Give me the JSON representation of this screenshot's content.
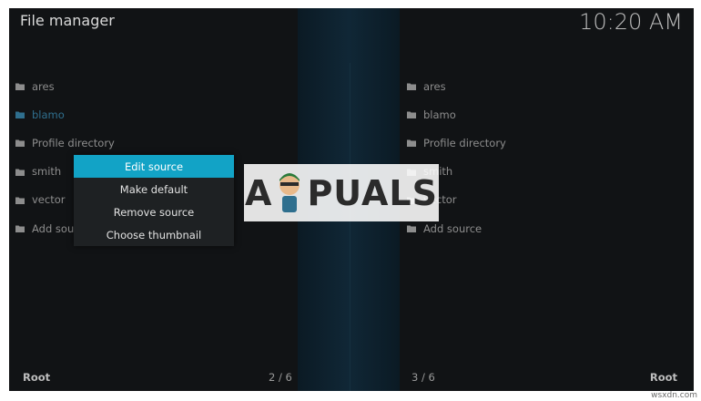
{
  "header": {
    "title": "File manager",
    "clock": "10:20 AM"
  },
  "left_pane": {
    "items": [
      {
        "label": "ares",
        "icon": "folder-icon"
      },
      {
        "label": "blamo",
        "icon": "folder-icon"
      },
      {
        "label": "Profile directory",
        "icon": "folder-icon"
      },
      {
        "label": "smith",
        "icon": "folder-icon"
      },
      {
        "label": "vector",
        "icon": "folder-icon"
      },
      {
        "label": "Add source",
        "icon": "folder-icon"
      }
    ],
    "footer_label": "Root",
    "page_counter": "2 / 6"
  },
  "right_pane": {
    "items": [
      {
        "label": "ares",
        "icon": "folder-icon"
      },
      {
        "label": "blamo",
        "icon": "folder-icon"
      },
      {
        "label": "Profile directory",
        "icon": "folder-icon"
      },
      {
        "label": "smith",
        "icon": "folder-icon"
      },
      {
        "label": "vector",
        "icon": "folder-icon"
      },
      {
        "label": "Add source",
        "icon": "folder-icon"
      }
    ],
    "footer_label": "Root",
    "page_counter": "3 / 6"
  },
  "context_menu": {
    "items": [
      {
        "label": "Edit source"
      },
      {
        "label": "Make default"
      },
      {
        "label": "Remove source"
      },
      {
        "label": "Choose thumbnail"
      }
    ]
  },
  "watermark": {
    "text_before": "A",
    "text_after": "PUALS"
  },
  "site_tag": "wsxdn.com",
  "colors": {
    "background": "#111315",
    "accent": "#12a3c6",
    "active_item": "#2f6f8e",
    "center_strip": "#102736"
  }
}
